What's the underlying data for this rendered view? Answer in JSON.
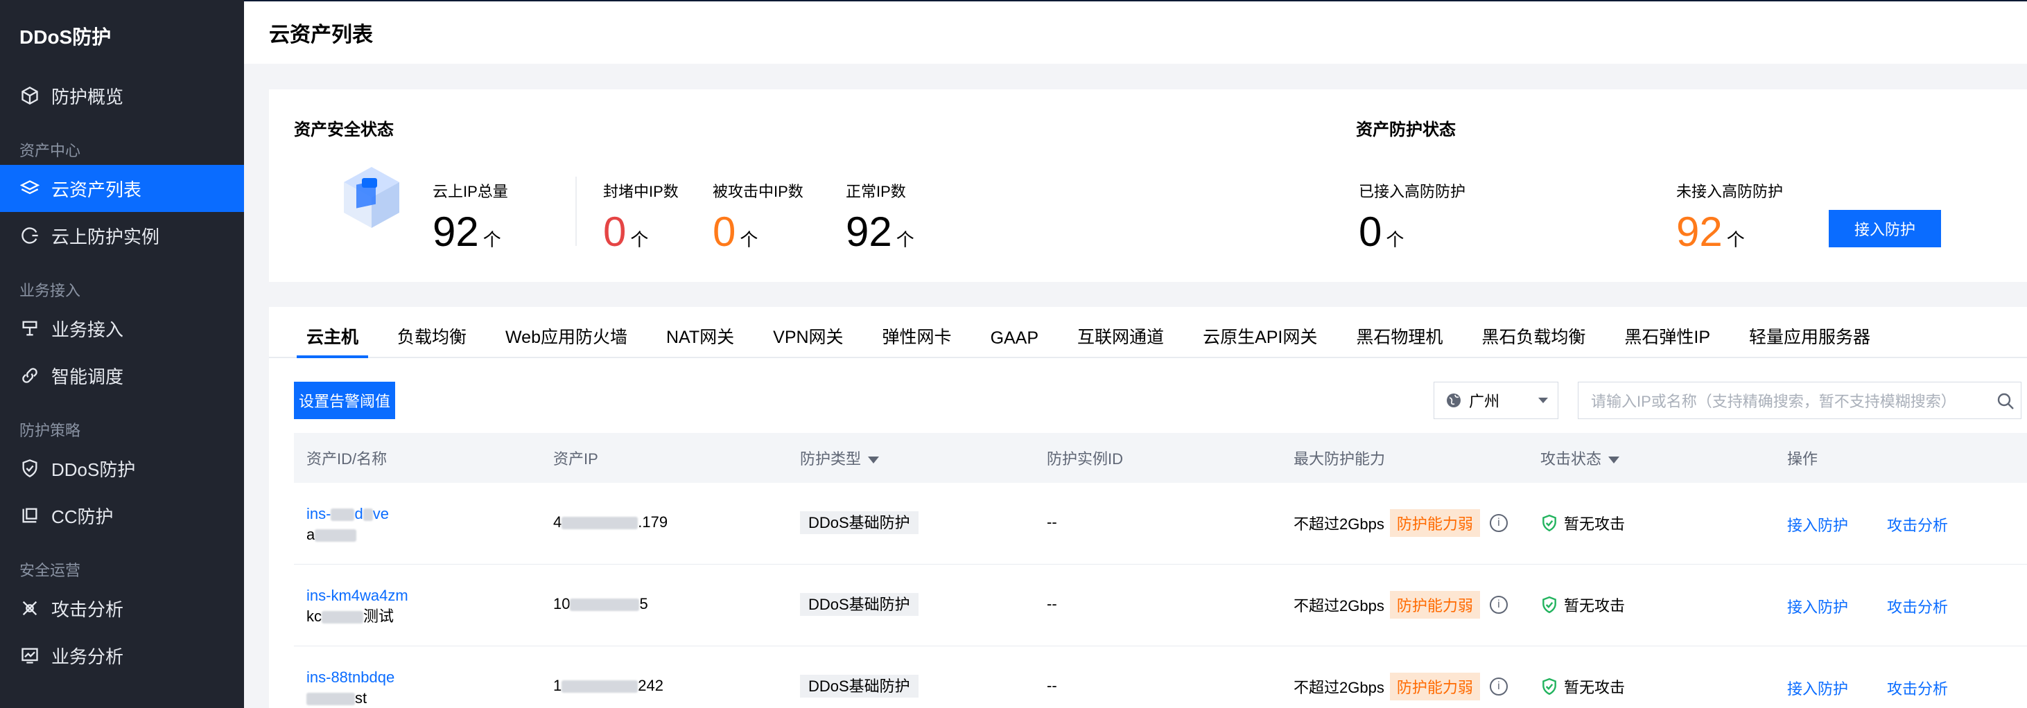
{
  "sidebar": {
    "brand": "DDoS防护",
    "items": [
      {
        "type": "item",
        "label": "防护概览",
        "icon": "cube-icon",
        "active": false
      },
      {
        "type": "group",
        "label": "资产中心"
      },
      {
        "type": "item",
        "label": "云资产列表",
        "icon": "layers-icon",
        "active": true
      },
      {
        "type": "item",
        "label": "云上防护实例",
        "icon": "ring-icon",
        "active": false
      },
      {
        "type": "group",
        "label": "业务接入"
      },
      {
        "type": "item",
        "label": "业务接入",
        "icon": "plug-icon",
        "active": false
      },
      {
        "type": "item",
        "label": "智能调度",
        "icon": "link-icon",
        "active": false
      },
      {
        "type": "group",
        "label": "防护策略"
      },
      {
        "type": "item",
        "label": "DDoS防护",
        "icon": "shield-icon",
        "active": false
      },
      {
        "type": "item",
        "label": "CC防护",
        "icon": "cc-icon",
        "active": false
      },
      {
        "type": "group",
        "label": "安全运营"
      },
      {
        "type": "item",
        "label": "攻击分析",
        "icon": "crosshair-icon",
        "active": false
      },
      {
        "type": "item",
        "label": "业务分析",
        "icon": "chart-icon",
        "active": false
      }
    ]
  },
  "header": {
    "title": "云资产列表"
  },
  "security_card": {
    "title": "资产安全状态",
    "stats": [
      {
        "label": "云上IP总量",
        "value": "92",
        "unit": "个",
        "color": "#000000"
      },
      {
        "label": "封堵中IP数",
        "value": "0",
        "unit": "个",
        "color": "#e54545"
      },
      {
        "label": "被攻击中IP数",
        "value": "0",
        "unit": "个",
        "color": "#ff7a1a"
      },
      {
        "label": "正常IP数",
        "value": "92",
        "unit": "个",
        "color": "#000000"
      }
    ]
  },
  "protection_card": {
    "title": "资产防护状态",
    "stats": [
      {
        "label": "已接入高防防护",
        "value": "0",
        "unit": "个",
        "color": "#000000"
      },
      {
        "label": "未接入高防防护",
        "value": "92",
        "unit": "个",
        "color": "#ff7a1a"
      }
    ],
    "button": "接入防护"
  },
  "tabs": [
    "云主机",
    "负载均衡",
    "Web应用防火墙",
    "NAT网关",
    "VPN网关",
    "弹性网卡",
    "GAAP",
    "互联网通道",
    "云原生API网关",
    "黑石物理机",
    "黑石负载均衡",
    "黑石弹性IP",
    "轻量应用服务器"
  ],
  "toolbar": {
    "alert_button": "设置告警阈值",
    "region": "广州",
    "search_placeholder": "请输入IP或名称（支持精确搜索，暂不支持模糊搜索）"
  },
  "table": {
    "columns": [
      "资产ID/名称",
      "资产IP",
      "防护类型",
      "防护实例ID",
      "最大防护能力",
      "攻击状态",
      "操作"
    ],
    "rows": [
      {
        "id": "ins-",
        "id_tail": "d",
        "id_tail2": "ve",
        "name_head": "a",
        "name_tail": "",
        "ip_head": "4",
        "ip_tail": ".179",
        "type": "DDoS基础防护",
        "instance": "--",
        "capacity": "不超过2Gbps",
        "weak": "防护能力弱",
        "status": "暂无攻击",
        "action1": "接入防护",
        "action2": "攻击分析"
      },
      {
        "id": "ins-km4wa4zm",
        "id_tail": "",
        "id_tail2": "",
        "name_head": "kc",
        "name_tail": "测试",
        "ip_head": "10",
        "ip_tail": "5",
        "type": "DDoS基础防护",
        "instance": "--",
        "capacity": "不超过2Gbps",
        "weak": "防护能力弱",
        "status": "暂无攻击",
        "action1": "接入防护",
        "action2": "攻击分析"
      },
      {
        "id": "ins-88tnbdqe",
        "id_tail": "",
        "id_tail2": "",
        "name_head": "",
        "name_tail": "st",
        "ip_head": "1",
        "ip_tail": "242",
        "type": "DDoS基础防护",
        "instance": "--",
        "capacity": "不超过2Gbps",
        "weak": "防护能力弱",
        "status": "暂无攻击",
        "action1": "接入防护",
        "action2": "攻击分析"
      }
    ]
  },
  "colors": {
    "accent": "#0a6cff",
    "sidebar_bg": "#21252f",
    "danger": "#e54545",
    "warning": "#ff7a1a",
    "success": "#22b35e"
  }
}
